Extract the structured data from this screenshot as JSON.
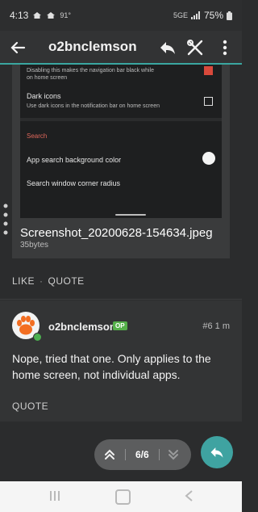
{
  "status_bar": {
    "time": "4:13",
    "temperature": "91°",
    "network": "5G",
    "network_sub": "E",
    "battery": "75%"
  },
  "top_bar": {
    "title": "o2bnclemson",
    "icons": [
      "back-arrow-icon",
      "reply-icon",
      "tools-icon",
      "more-vertical-icon"
    ]
  },
  "screenshot_content": {
    "nav_bar_pref_line1": "Disabling this makes the navigation bar black while",
    "nav_bar_pref_line2": "on home screen",
    "dark_icons_title": "Dark icons",
    "dark_icons_desc": "Use dark icons in the notification bar on home screen",
    "search_header": "Search",
    "search_bg_label": "App search background color",
    "search_radius_label": "Search window corner radius",
    "accent_color": "#d9493b"
  },
  "attachment": {
    "filename": "Screenshot_20200628-154634.jpeg",
    "size": "35bytes"
  },
  "first_post_actions": {
    "like": "LIKE",
    "separator": "·",
    "quote": "QUOTE"
  },
  "reply_post": {
    "author": "o2bnclemson",
    "badge": "OP",
    "post_number": "#6",
    "time_ago": "1 m",
    "body": "Nope, tried that one. Only applies to the home screen, not individual apps.",
    "quote": "QUOTE"
  },
  "pager": {
    "position": "6/6"
  },
  "colors": {
    "accent": "#3fa3a1",
    "badge_green": "#55b04a",
    "background": "#2b2c2d"
  }
}
